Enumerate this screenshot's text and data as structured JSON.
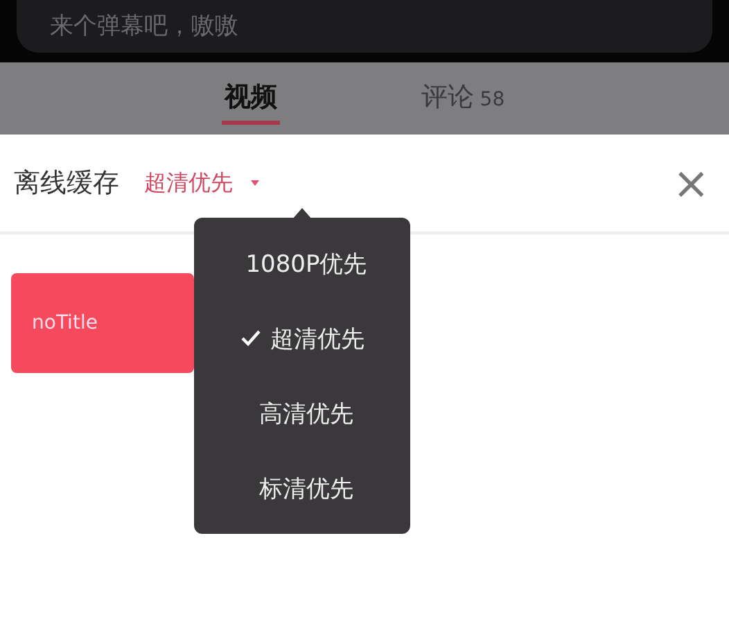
{
  "danmaku_field": {
    "placeholder": "来个弹幕吧，嗷嗷"
  },
  "tabs": [
    {
      "label": "视频",
      "selected": true
    },
    {
      "label": "评论",
      "count": "58",
      "selected": false
    }
  ],
  "sheet": {
    "title": "离线缓存",
    "quality": "超清优先",
    "close": "×"
  },
  "videos": [
    {
      "title": "noTitle"
    }
  ],
  "quality_menu": {
    "items": [
      {
        "label": "1080P优先",
        "selected": false
      },
      {
        "label": "超清优先",
        "selected": true
      },
      {
        "label": "高清优先",
        "selected": false
      },
      {
        "label": "标清优先",
        "selected": false
      }
    ]
  }
}
